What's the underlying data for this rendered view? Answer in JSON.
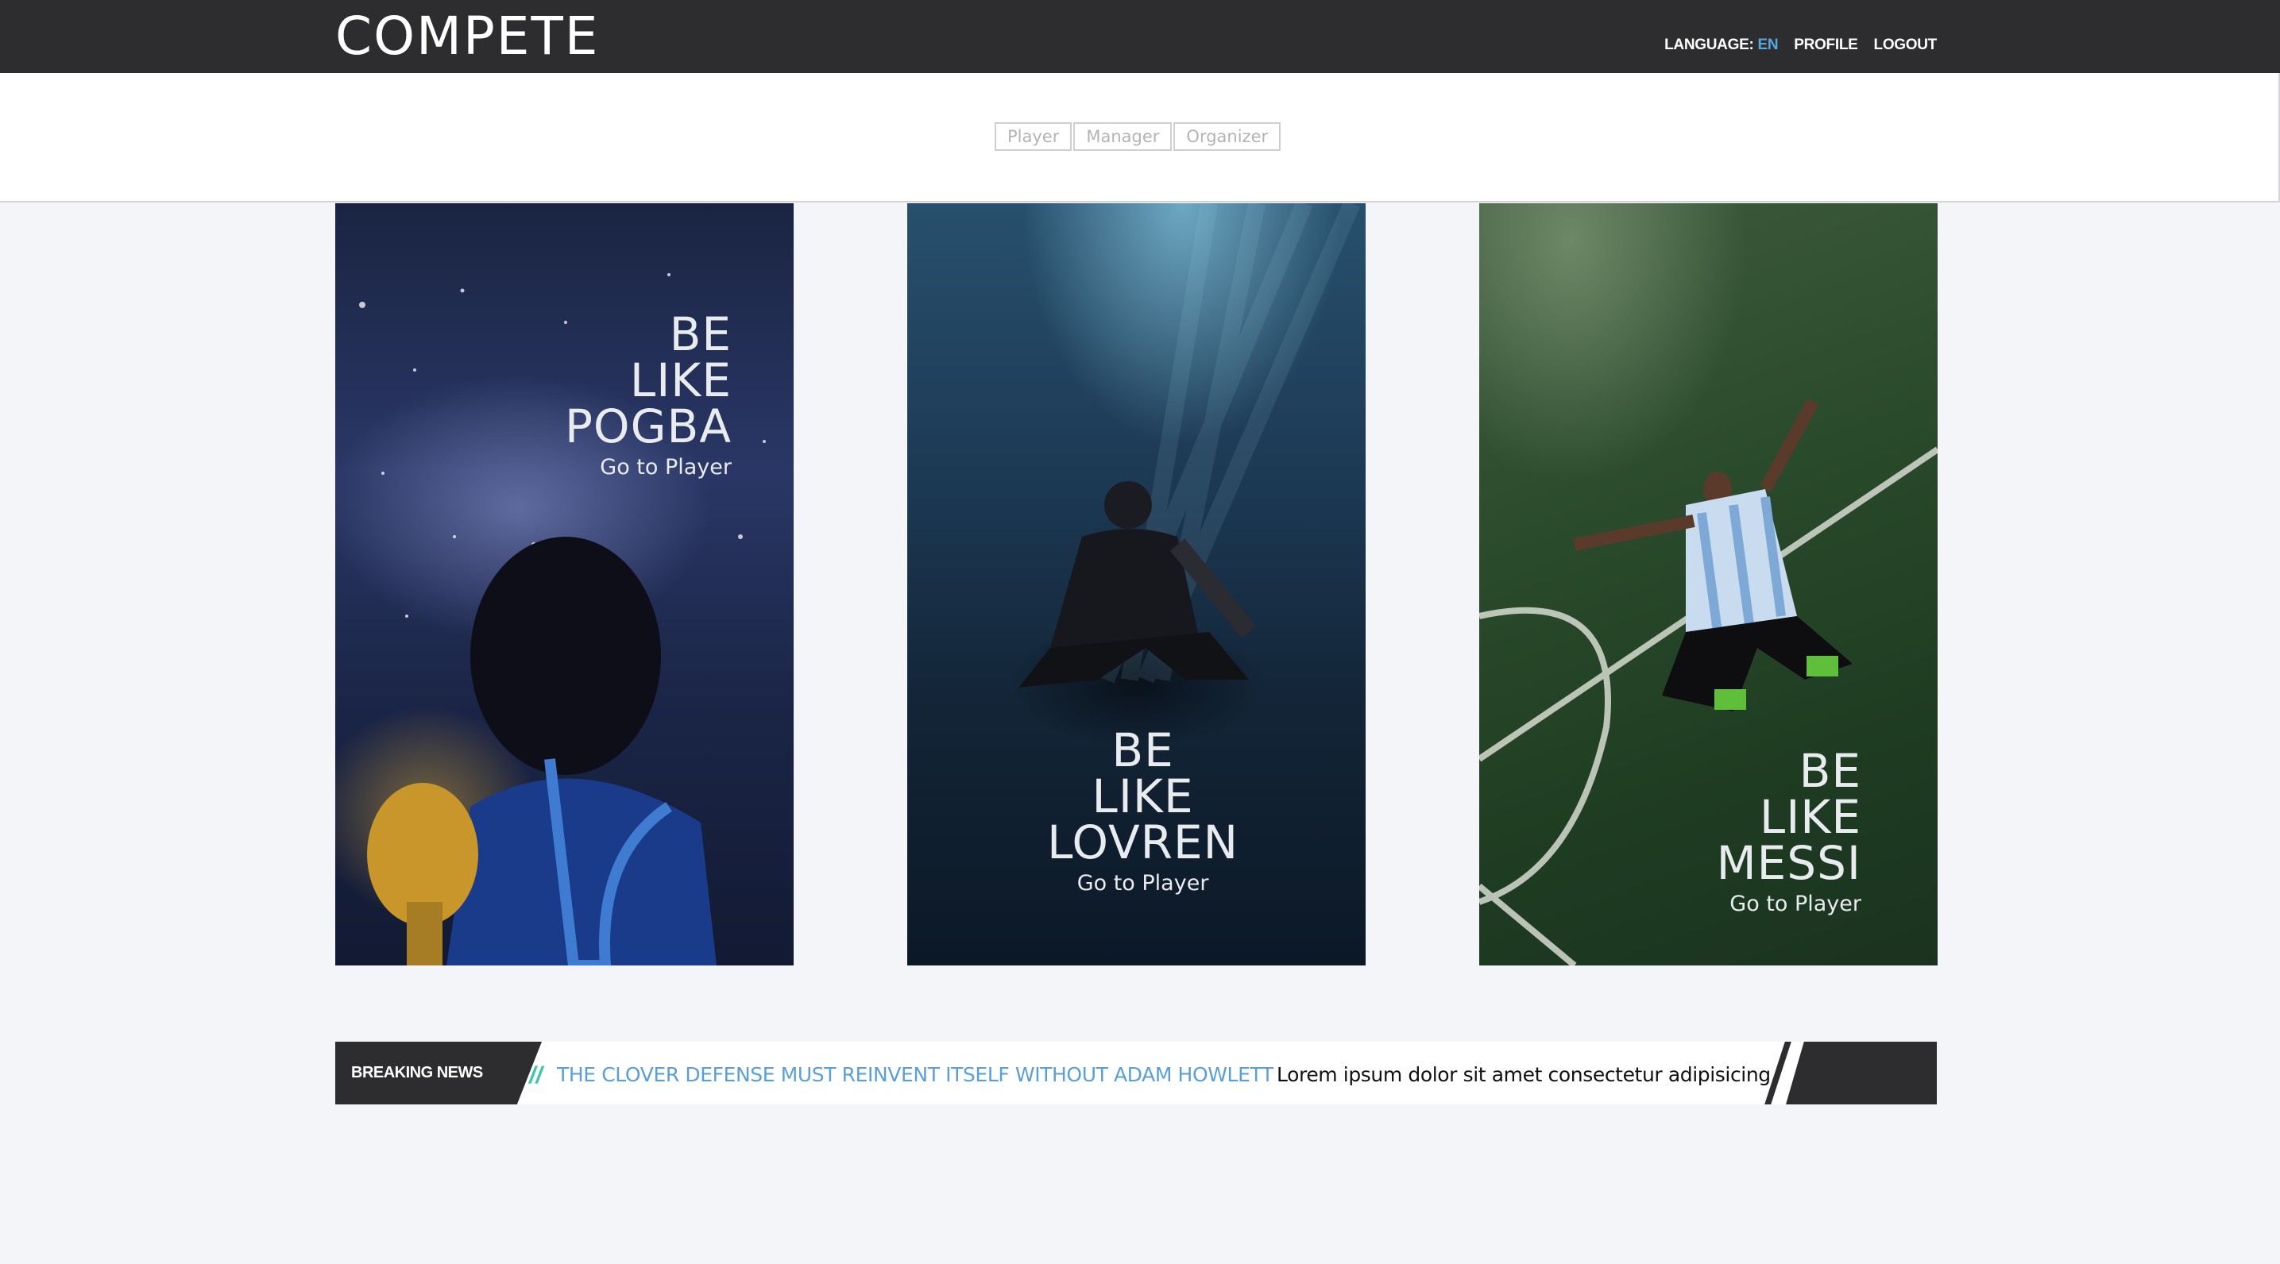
{
  "header": {
    "logo": "COMPETE",
    "language_label": "LANGUAGE:",
    "language_code": "EN",
    "profile_link": "PROFILE",
    "logout_link": "LOGOUT"
  },
  "role_tabs": [
    "Player",
    "Manager",
    "Organizer"
  ],
  "cards": [
    {
      "headline": "BE\nLIKE\nPOGBA",
      "cta": "Go to Player"
    },
    {
      "headline": "BE\nLIKE\nLOVREN",
      "cta": "Go to Player"
    },
    {
      "headline": "BE\nLIKE\nMESSI",
      "cta": "Go to Player"
    }
  ],
  "ticker": {
    "label": "BREAKING NEWS",
    "headline": "THE CLOVER DEFENSE MUST REINVENT ITSELF WITHOUT ADAM HOWLETT",
    "body": "Lorem ipsum dolor sit amet consectetur adipisicing."
  },
  "colors": {
    "topbar": "#2d2d2f",
    "accent_blue": "#58a6e0",
    "ticker_accent": "#3fc5a7"
  }
}
